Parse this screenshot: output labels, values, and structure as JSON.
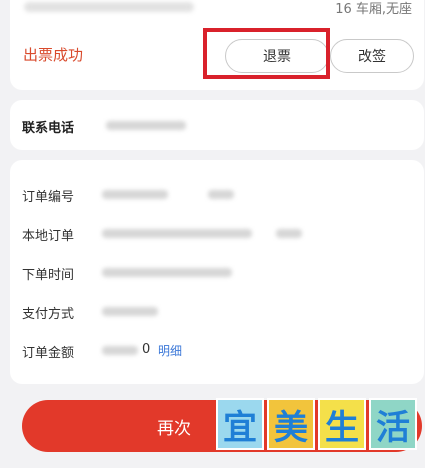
{
  "ticket": {
    "carriage_text": "16 车厢,无座",
    "status": "出票成功",
    "refund_label": "退票",
    "change_label": "改签"
  },
  "contact": {
    "phone_label": "联系电话"
  },
  "order": {
    "rows": [
      {
        "label": "订单编号"
      },
      {
        "label": "本地订单"
      },
      {
        "label": "下单时间"
      },
      {
        "label": "支付方式"
      },
      {
        "label": "订单金额"
      }
    ],
    "amount_partial": "0",
    "detail_link": "明细"
  },
  "bottom_button": {
    "label": "再次"
  },
  "watermark": {
    "chars": [
      "宜",
      "美",
      "生",
      "活"
    ],
    "tile_colors": [
      "#9bd8ee",
      "#f2c43c",
      "#f4e04a",
      "#8fd6c6"
    ]
  },
  "colors": {
    "status_red": "#d94a2c",
    "highlight_red": "#d9212b",
    "button_red": "#e2392a",
    "link_blue": "#3b78d8"
  }
}
